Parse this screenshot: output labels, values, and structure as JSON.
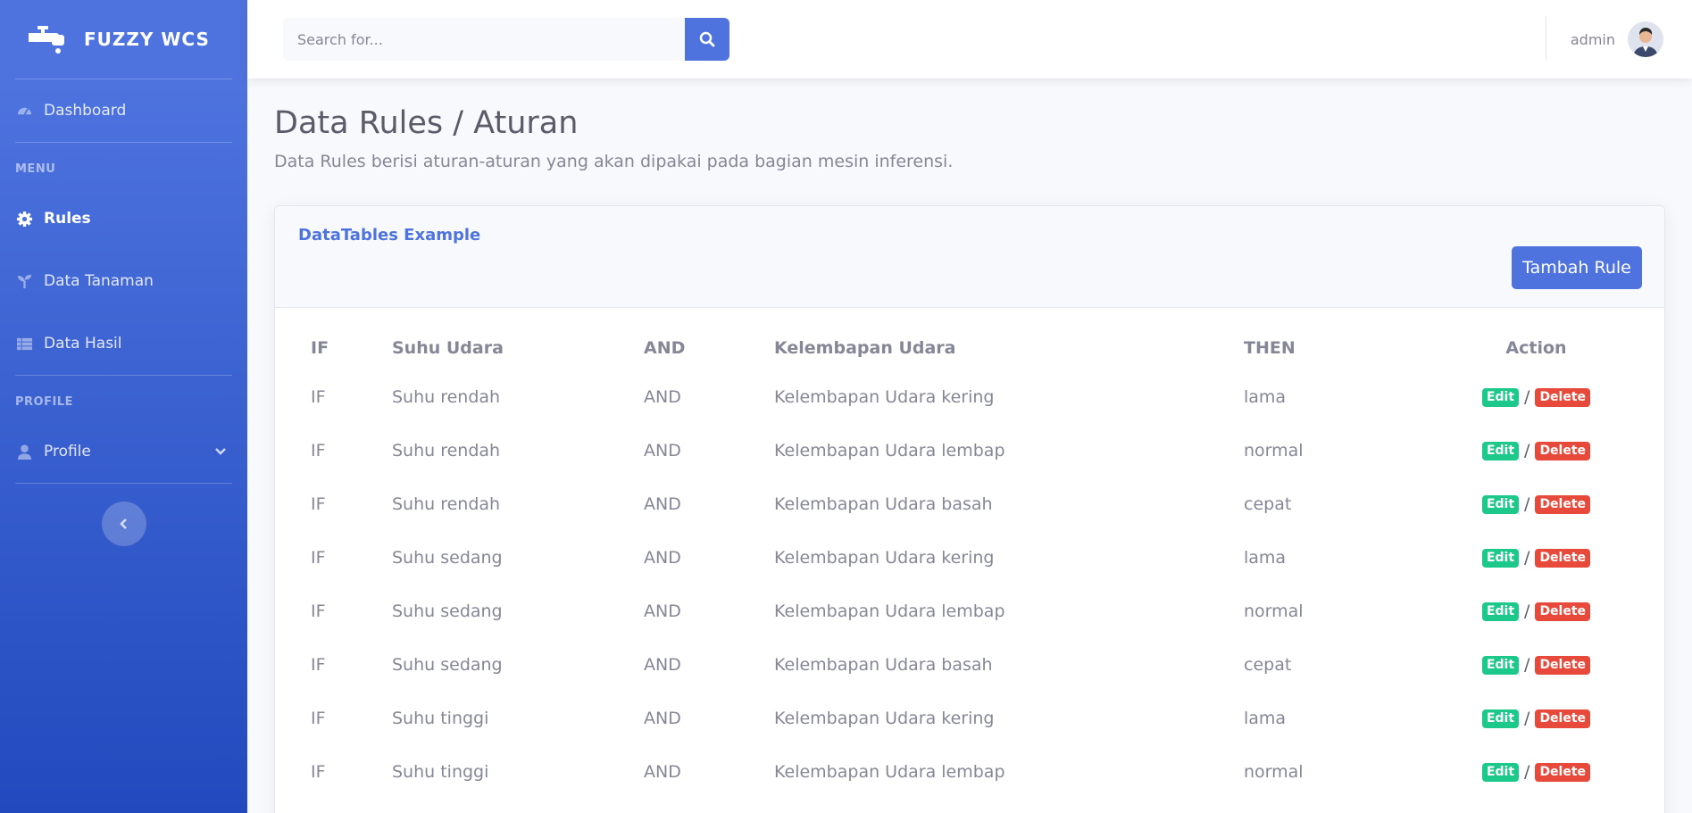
{
  "brand": {
    "name": "FUZZY WCS",
    "icon": "faucet-icon"
  },
  "sidebar": {
    "dashboard": "Dashboard",
    "heading_menu": "MENU",
    "items": [
      {
        "label": "Rules",
        "icon": "gear-icon",
        "active": true
      },
      {
        "label": "Data Tanaman",
        "icon": "seedling-icon",
        "active": false
      },
      {
        "label": "Data Hasil",
        "icon": "table-icon",
        "active": false
      }
    ],
    "heading_profile": "PROFILE",
    "profile": "Profile"
  },
  "topbar": {
    "search_placeholder": "Search for...",
    "user_name": "admin"
  },
  "page": {
    "title": "Data Rules / Aturan",
    "description": "Data Rules berisi aturan-aturan yang akan dipakai pada bagian mesin inferensi."
  },
  "card": {
    "title": "DataTables Example",
    "add_button": "Tambah Rule"
  },
  "table": {
    "headers": [
      "IF",
      "Suhu Udara",
      "AND",
      "Kelembapan Udara",
      "THEN",
      "Action"
    ],
    "rows": [
      [
        "IF",
        "Suhu rendah",
        "AND",
        "Kelembapan Udara kering",
        "lama"
      ],
      [
        "IF",
        "Suhu rendah",
        "AND",
        "Kelembapan Udara lembap",
        "normal"
      ],
      [
        "IF",
        "Suhu rendah",
        "AND",
        "Kelembapan Udara basah",
        "cepat"
      ],
      [
        "IF",
        "Suhu sedang",
        "AND",
        "Kelembapan Udara kering",
        "lama"
      ],
      [
        "IF",
        "Suhu sedang",
        "AND",
        "Kelembapan Udara lembap",
        "normal"
      ],
      [
        "IF",
        "Suhu sedang",
        "AND",
        "Kelembapan Udara basah",
        "cepat"
      ],
      [
        "IF",
        "Suhu tinggi",
        "AND",
        "Kelembapan Udara kering",
        "lama"
      ],
      [
        "IF",
        "Suhu tinggi",
        "AND",
        "Kelembapan Udara lembap",
        "normal"
      ]
    ],
    "edit_label": "Edit",
    "delete_label": "Delete",
    "separator": "/"
  },
  "colors": {
    "primary": "#4e73df",
    "success": "#1cc88a",
    "danger": "#e74a3b"
  }
}
